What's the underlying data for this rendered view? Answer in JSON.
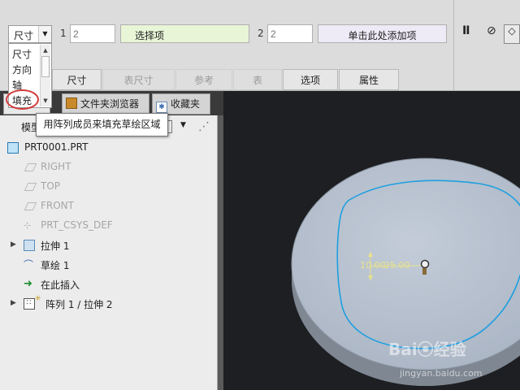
{
  "dashboard": {
    "type_select": {
      "value": "尺寸",
      "options": [
        "尺寸",
        "方向",
        "轴",
        "填充"
      ]
    },
    "dir1": {
      "number": "1",
      "count_placeholder": "2",
      "collector_label": "选择项"
    },
    "dir2": {
      "number": "2",
      "count_placeholder": "2",
      "collector_label": "单击此处添加项"
    },
    "controls": {
      "pause_glyph": "II",
      "cancel_glyph": "⊘",
      "clip_glyph": "◇"
    },
    "tabs": [
      {
        "label": "尺寸",
        "enabled": true
      },
      {
        "label": "表尺寸",
        "enabled": false
      },
      {
        "label": "参考",
        "enabled": false
      },
      {
        "label": "表",
        "enabled": false
      },
      {
        "label": "选项",
        "enabled": true
      },
      {
        "label": "属性",
        "enabled": true
      }
    ]
  },
  "tooltip": "用阵列成员来填充草绘区域",
  "navigator": {
    "tabs": [
      {
        "label": "文件夹浏览器",
        "icon": "folder-icon"
      },
      {
        "label": "收藏夹",
        "icon": "favorites-icon"
      }
    ],
    "toolbar_label": "模型",
    "tree": [
      {
        "label": "PRT0001.PRT",
        "icon": "part-icon",
        "dim": false,
        "expandable": false
      },
      {
        "label": "RIGHT",
        "icon": "datum-plane-icon",
        "dim": true,
        "expandable": false
      },
      {
        "label": "TOP",
        "icon": "datum-plane-icon",
        "dim": true,
        "expandable": false
      },
      {
        "label": "FRONT",
        "icon": "datum-plane-icon",
        "dim": true,
        "expandable": false
      },
      {
        "label": "PRT_CSYS_DEF",
        "icon": "csys-icon",
        "dim": true,
        "expandable": false
      },
      {
        "label": "拉伸 1",
        "icon": "extrude-icon",
        "dim": false,
        "expandable": true
      },
      {
        "label": "草绘 1",
        "icon": "sketch-icon",
        "dim": false,
        "expandable": false
      },
      {
        "label": "在此插入",
        "icon": "insert-here-icon",
        "dim": false,
        "expandable": false
      },
      {
        "label": "阵列 1 / 拉伸 2",
        "icon": "pattern-icon",
        "dim": false,
        "expandable": true
      }
    ]
  },
  "graphics": {
    "dimensions": {
      "spacing": "10.00",
      "distance": "25.00"
    }
  },
  "watermark": {
    "brand": "Bai⦿经验",
    "url": "jingyan.baidu.com"
  },
  "colors": {
    "graphics_bg": "#1e1f22",
    "disk_face": "#b2bdcc",
    "disk_side": "#7e8792",
    "sketch_curve": "#1e9fe0",
    "dimension": "#e8e28a",
    "highlight": "#d03a3a"
  }
}
